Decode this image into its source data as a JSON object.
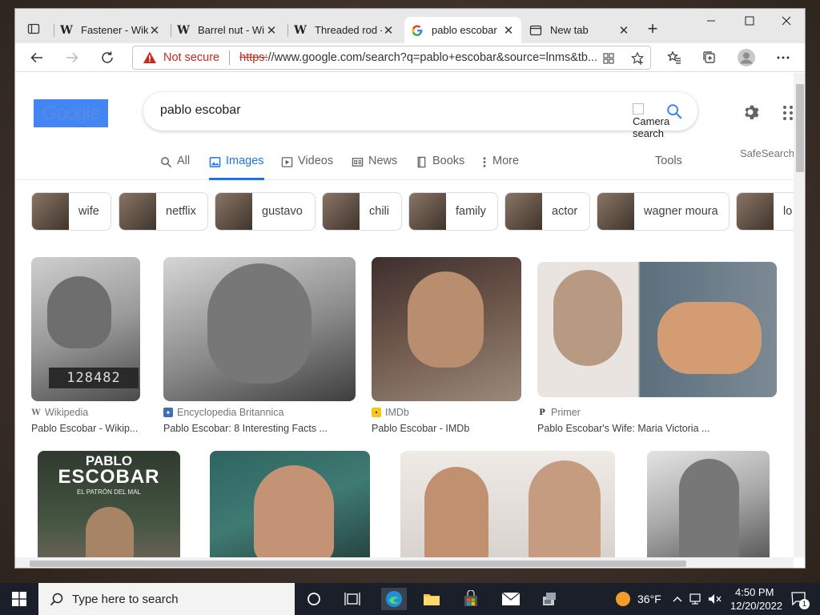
{
  "tabs": [
    {
      "label": "Fastener - Wiki",
      "favicon": "W",
      "active": false
    },
    {
      "label": "Barrel nut - Wiki",
      "favicon": "W",
      "active": false
    },
    {
      "label": "Threaded rod -",
      "favicon": "W",
      "active": false
    },
    {
      "label": "pablo escobar",
      "favicon": "G",
      "active": true
    },
    {
      "label": "New tab",
      "favicon": "newtab-icon",
      "active": false
    }
  ],
  "address": {
    "security": "Not secure",
    "scheme": "https:",
    "rest": "//www.google.com/search?q=pablo+escobar&source=lnms&tb..."
  },
  "search": {
    "logo": "Google",
    "query": "pablo escobar",
    "camera_alt": "Camera search",
    "safesearch": "SafeSearch"
  },
  "nav": {
    "all": "All",
    "images": "Images",
    "videos": "Videos",
    "news": "News",
    "books": "Books",
    "more": "More",
    "tools": "Tools"
  },
  "chips": [
    "wife",
    "netflix",
    "gustavo",
    "chili",
    "family",
    "actor",
    "wagner moura",
    "lo"
  ],
  "results_row1": [
    {
      "source": "Wikipedia",
      "caption": "Pablo Escobar - Wikip..."
    },
    {
      "source": "Encyclopedia Britannica",
      "caption": "Pablo Escobar: 8 Interesting Facts ..."
    },
    {
      "source": "IMDb",
      "caption": "Pablo Escobar - IMDb"
    },
    {
      "source": "Primer",
      "caption": "Pablo Escobar's Wife: Maria Victoria ..."
    }
  ],
  "results_row2": [
    {
      "title_line1": "PABLO",
      "title_line2": "ESCOBAR",
      "subtitle": "EL PATRÓN DEL MAL"
    },
    {},
    {},
    {}
  ],
  "mugshot_number": "128482",
  "taskbar": {
    "search_placeholder": "Type here to search",
    "temperature": "36°F",
    "time": "4:50 PM",
    "date": "12/20/2022",
    "notifications": "1"
  },
  "colors": {
    "accent": "#1a73e8",
    "not_secure": "#c42b1c",
    "taskbar": "#1b1f2a"
  }
}
